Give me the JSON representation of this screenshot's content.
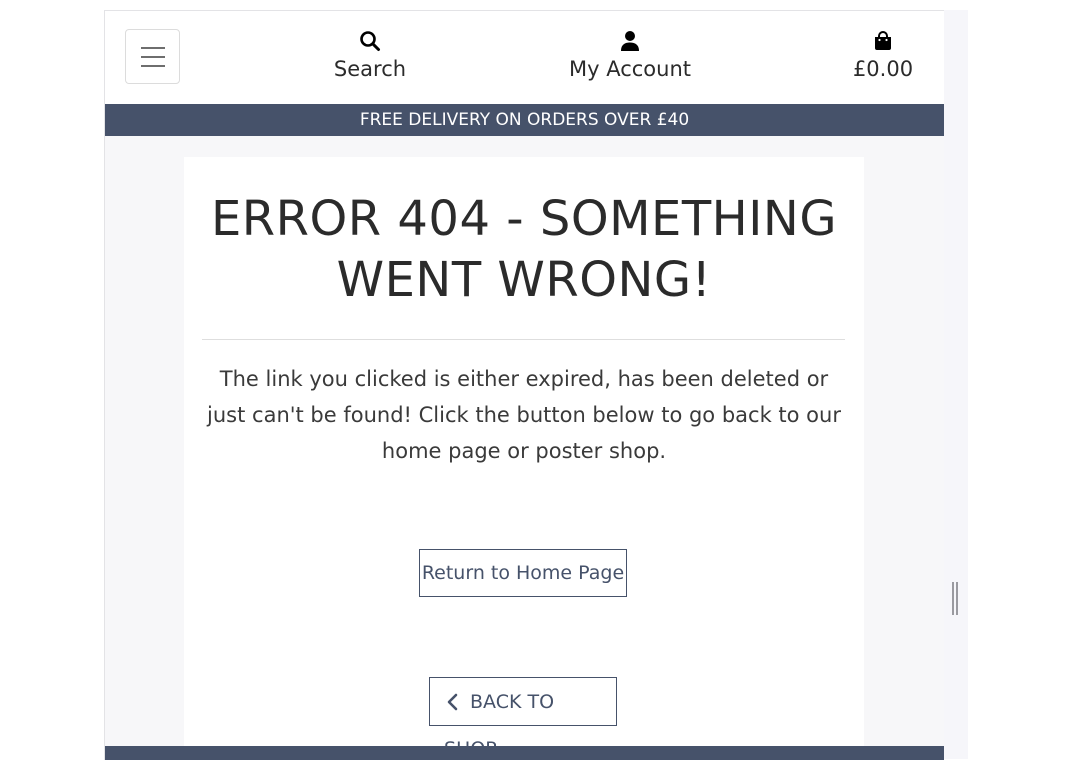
{
  "nav": {
    "search_label": "Search",
    "account_label": "My Account",
    "bag_total": "£0.00",
    "icons": [
      "menu-icon",
      "search-icon",
      "user-icon",
      "shopping-bag-icon"
    ]
  },
  "banner": {
    "text": "FREE DELIVERY ON ORDERS OVER £40"
  },
  "error": {
    "title": "ERROR 404 - SOMETHING WENT WRONG!",
    "message": "The link you clicked is either expired, has been deleted or just can't be found! Click the button below to go back to our home page or poster shop."
  },
  "buttons": {
    "home_label": "Return to Home Page",
    "shop_label": "BACK TO SHOP"
  },
  "colors": {
    "brand": "#46526a",
    "text": "#2b2b2b",
    "background": "#f7f7f9"
  }
}
